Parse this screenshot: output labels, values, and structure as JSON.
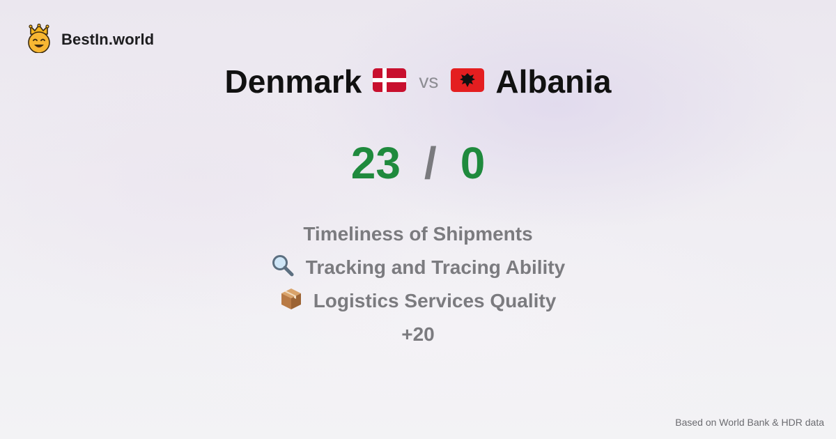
{
  "brand": {
    "name": "BestIn.world",
    "icon": "crown-smiley-icon"
  },
  "comparison": {
    "left": {
      "country": "Denmark",
      "flag": "denmark-flag-icon"
    },
    "vs_label": "vs",
    "right": {
      "country": "Albania",
      "flag": "albania-flag-icon"
    }
  },
  "score": {
    "left": "23",
    "separator": "/",
    "right": "0"
  },
  "metrics": [
    {
      "icon": "",
      "label": "Timeliness of Shipments"
    },
    {
      "icon": "magnifying-glass-icon",
      "label": "Tracking and Tracing Ability"
    },
    {
      "icon": "package-icon",
      "label": "Logistics Services Quality"
    }
  ],
  "more_count": "+20",
  "footer": {
    "source": "Based on World Bank & HDR data"
  },
  "colors": {
    "score": "#1f8a3d",
    "title": "#111111",
    "muted": "#7b7b7f",
    "denmark_red": "#c8102e",
    "albania_red": "#e41e20"
  }
}
